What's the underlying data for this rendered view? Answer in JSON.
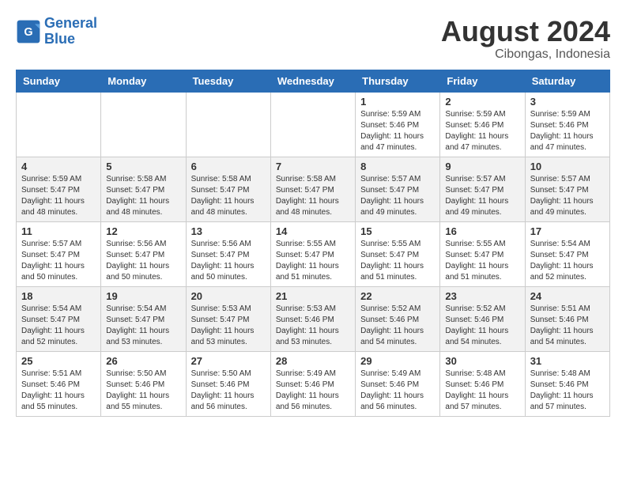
{
  "header": {
    "logo_line1": "General",
    "logo_line2": "Blue",
    "month_year": "August 2024",
    "location": "Cibongas, Indonesia"
  },
  "weekdays": [
    "Sunday",
    "Monday",
    "Tuesday",
    "Wednesday",
    "Thursday",
    "Friday",
    "Saturday"
  ],
  "weeks": [
    [
      {
        "day": "",
        "info": ""
      },
      {
        "day": "",
        "info": ""
      },
      {
        "day": "",
        "info": ""
      },
      {
        "day": "",
        "info": ""
      },
      {
        "day": "1",
        "info": "Sunrise: 5:59 AM\nSunset: 5:46 PM\nDaylight: 11 hours\nand 47 minutes."
      },
      {
        "day": "2",
        "info": "Sunrise: 5:59 AM\nSunset: 5:46 PM\nDaylight: 11 hours\nand 47 minutes."
      },
      {
        "day": "3",
        "info": "Sunrise: 5:59 AM\nSunset: 5:46 PM\nDaylight: 11 hours\nand 47 minutes."
      }
    ],
    [
      {
        "day": "4",
        "info": "Sunrise: 5:59 AM\nSunset: 5:47 PM\nDaylight: 11 hours\nand 48 minutes."
      },
      {
        "day": "5",
        "info": "Sunrise: 5:58 AM\nSunset: 5:47 PM\nDaylight: 11 hours\nand 48 minutes."
      },
      {
        "day": "6",
        "info": "Sunrise: 5:58 AM\nSunset: 5:47 PM\nDaylight: 11 hours\nand 48 minutes."
      },
      {
        "day": "7",
        "info": "Sunrise: 5:58 AM\nSunset: 5:47 PM\nDaylight: 11 hours\nand 48 minutes."
      },
      {
        "day": "8",
        "info": "Sunrise: 5:57 AM\nSunset: 5:47 PM\nDaylight: 11 hours\nand 49 minutes."
      },
      {
        "day": "9",
        "info": "Sunrise: 5:57 AM\nSunset: 5:47 PM\nDaylight: 11 hours\nand 49 minutes."
      },
      {
        "day": "10",
        "info": "Sunrise: 5:57 AM\nSunset: 5:47 PM\nDaylight: 11 hours\nand 49 minutes."
      }
    ],
    [
      {
        "day": "11",
        "info": "Sunrise: 5:57 AM\nSunset: 5:47 PM\nDaylight: 11 hours\nand 50 minutes."
      },
      {
        "day": "12",
        "info": "Sunrise: 5:56 AM\nSunset: 5:47 PM\nDaylight: 11 hours\nand 50 minutes."
      },
      {
        "day": "13",
        "info": "Sunrise: 5:56 AM\nSunset: 5:47 PM\nDaylight: 11 hours\nand 50 minutes."
      },
      {
        "day": "14",
        "info": "Sunrise: 5:55 AM\nSunset: 5:47 PM\nDaylight: 11 hours\nand 51 minutes."
      },
      {
        "day": "15",
        "info": "Sunrise: 5:55 AM\nSunset: 5:47 PM\nDaylight: 11 hours\nand 51 minutes."
      },
      {
        "day": "16",
        "info": "Sunrise: 5:55 AM\nSunset: 5:47 PM\nDaylight: 11 hours\nand 51 minutes."
      },
      {
        "day": "17",
        "info": "Sunrise: 5:54 AM\nSunset: 5:47 PM\nDaylight: 11 hours\nand 52 minutes."
      }
    ],
    [
      {
        "day": "18",
        "info": "Sunrise: 5:54 AM\nSunset: 5:47 PM\nDaylight: 11 hours\nand 52 minutes."
      },
      {
        "day": "19",
        "info": "Sunrise: 5:54 AM\nSunset: 5:47 PM\nDaylight: 11 hours\nand 53 minutes."
      },
      {
        "day": "20",
        "info": "Sunrise: 5:53 AM\nSunset: 5:47 PM\nDaylight: 11 hours\nand 53 minutes."
      },
      {
        "day": "21",
        "info": "Sunrise: 5:53 AM\nSunset: 5:46 PM\nDaylight: 11 hours\nand 53 minutes."
      },
      {
        "day": "22",
        "info": "Sunrise: 5:52 AM\nSunset: 5:46 PM\nDaylight: 11 hours\nand 54 minutes."
      },
      {
        "day": "23",
        "info": "Sunrise: 5:52 AM\nSunset: 5:46 PM\nDaylight: 11 hours\nand 54 minutes."
      },
      {
        "day": "24",
        "info": "Sunrise: 5:51 AM\nSunset: 5:46 PM\nDaylight: 11 hours\nand 54 minutes."
      }
    ],
    [
      {
        "day": "25",
        "info": "Sunrise: 5:51 AM\nSunset: 5:46 PM\nDaylight: 11 hours\nand 55 minutes."
      },
      {
        "day": "26",
        "info": "Sunrise: 5:50 AM\nSunset: 5:46 PM\nDaylight: 11 hours\nand 55 minutes."
      },
      {
        "day": "27",
        "info": "Sunrise: 5:50 AM\nSunset: 5:46 PM\nDaylight: 11 hours\nand 56 minutes."
      },
      {
        "day": "28",
        "info": "Sunrise: 5:49 AM\nSunset: 5:46 PM\nDaylight: 11 hours\nand 56 minutes."
      },
      {
        "day": "29",
        "info": "Sunrise: 5:49 AM\nSunset: 5:46 PM\nDaylight: 11 hours\nand 56 minutes."
      },
      {
        "day": "30",
        "info": "Sunrise: 5:48 AM\nSunset: 5:46 PM\nDaylight: 11 hours\nand 57 minutes."
      },
      {
        "day": "31",
        "info": "Sunrise: 5:48 AM\nSunset: 5:46 PM\nDaylight: 11 hours\nand 57 minutes."
      }
    ]
  ]
}
